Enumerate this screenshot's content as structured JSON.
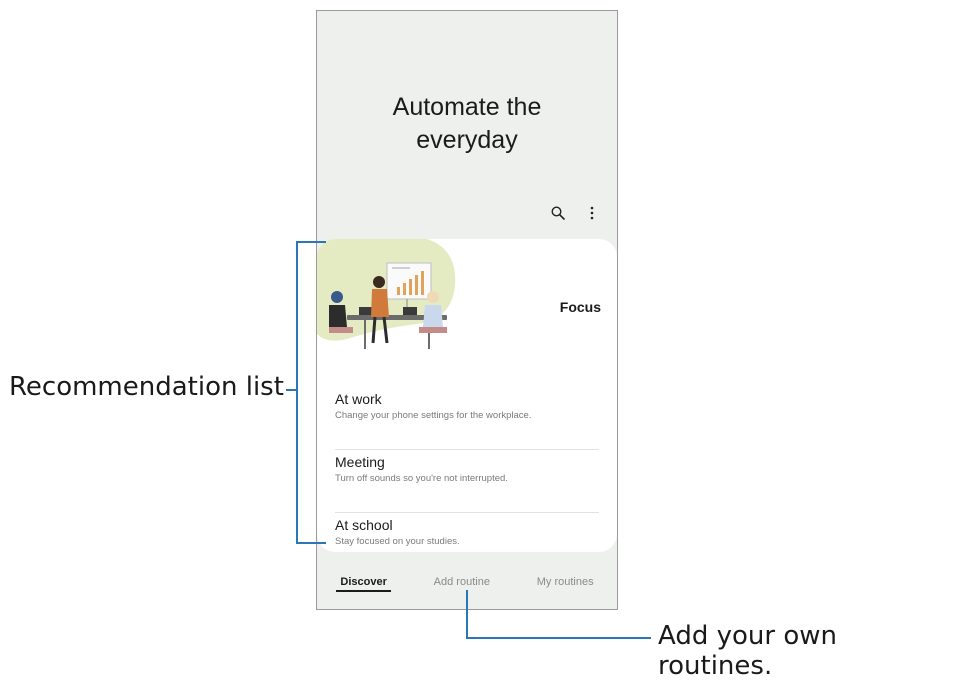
{
  "hero": {
    "title": "Automate the\neveryday"
  },
  "toolbar": {
    "search_icon": "search-icon",
    "more_icon": "more-vert-icon"
  },
  "card": {
    "featured_label": "Focus",
    "items": [
      {
        "title": "At work",
        "desc": "Change your phone settings for the workplace."
      },
      {
        "title": "Meeting",
        "desc": "Turn off sounds so you're not interrupted."
      },
      {
        "title": "At school",
        "desc": "Stay focused on your studies."
      }
    ]
  },
  "nav": {
    "tabs": [
      {
        "label": "Discover"
      },
      {
        "label": "Add routine"
      },
      {
        "label": "My routines"
      }
    ]
  },
  "annotations": {
    "left": "Recommendation list",
    "bottom": "Add your own routines."
  },
  "colors": {
    "annotation_line": "#2a77b8",
    "illustration_bg": "#e4ebc2"
  }
}
